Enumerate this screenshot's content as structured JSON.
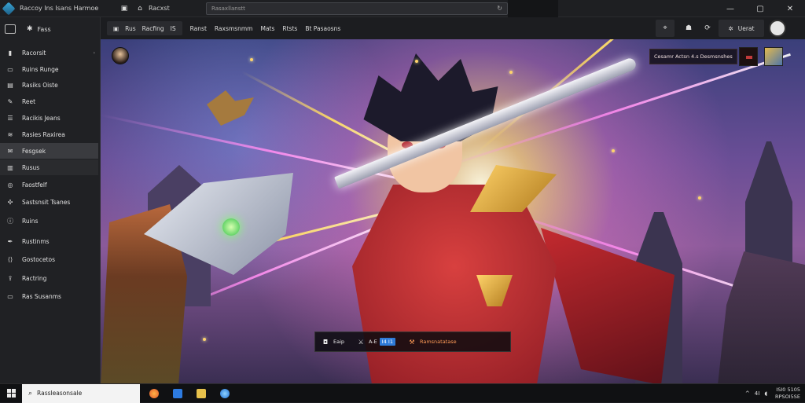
{
  "titlebar": {
    "title": "Raccoy Ins Isans Harmoe",
    "tab_label": "Racxst",
    "search_placeholder": "Rasaxllanstt",
    "controls": [
      "minimize",
      "maximize",
      "close"
    ]
  },
  "sidebar": {
    "header_label": "Fass",
    "items": [
      {
        "label": "Racorsit",
        "icon": "bookmark-icon"
      },
      {
        "label": "Ruins Runge",
        "icon": "folder-icon"
      },
      {
        "label": "Rasiks Oiste",
        "icon": "document-icon"
      },
      {
        "label": "Reet",
        "icon": "edit-icon"
      },
      {
        "label": "Racikis Jeans",
        "icon": "list-icon"
      },
      {
        "label": "Rasies Raxirea",
        "icon": "layers-icon"
      },
      {
        "label": "Fesgsek",
        "icon": "chat-icon"
      },
      {
        "label": "Rusus",
        "icon": "inbox-icon"
      },
      {
        "label": "Faostfelf",
        "icon": "globe-icon"
      },
      {
        "label": "Sastsnsit Tsanes",
        "icon": "puzzle-icon"
      },
      {
        "label": "Ruins",
        "icon": "info-icon"
      },
      {
        "label": "Rustinms",
        "icon": "pen-icon"
      },
      {
        "label": "Gostocetos",
        "icon": "code-icon"
      },
      {
        "label": "Ractring",
        "icon": "share-icon"
      },
      {
        "label": "Ras Susanms",
        "icon": "folder-icon"
      }
    ]
  },
  "toolbar": {
    "group": [
      "Rus",
      "Racfing",
      "IS"
    ],
    "items": [
      "Ranst",
      "Raxsmsnmm",
      "Mats",
      "Rtsts",
      "Bt Pasaosns"
    ],
    "right_label": "Uerat",
    "right_icons": [
      "pin-icon",
      "bell-icon",
      "refresh-icon",
      "settings-icon"
    ]
  },
  "hud": {
    "top_right_text": "Cesamr Actsn 4.s Desmsnshes",
    "bottom": {
      "seg1": "Eaip",
      "seg2_prefix": "A-E",
      "seg2_chip": "I4 I1",
      "seg3": "Ramsnatatase"
    }
  },
  "taskbar": {
    "search_text": "Rassleasonsale",
    "clock_time": "ISI0 5105",
    "clock_date": "RPSOI5SE",
    "tray_text": "4I"
  },
  "colors": {
    "accent": "#2f7bd8",
    "sidebar_bg": "#202124",
    "active_item": "#3a3b3f"
  }
}
